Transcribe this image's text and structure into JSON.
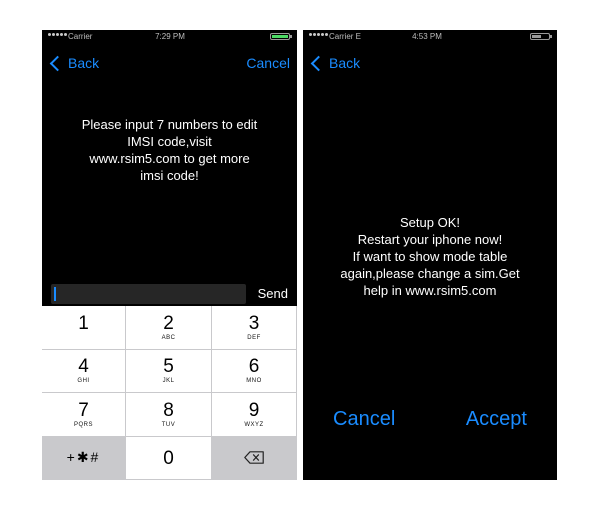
{
  "left_screen": {
    "status": {
      "carrier": "Carrier",
      "time": "7:29 PM",
      "battery_color": "#4cd964"
    },
    "nav": {
      "back_label": "Back",
      "cancel_label": "Cancel"
    },
    "message": "Please input 7 numbers to edit\nIMSI code,visit\nwww.rsim5.com to get more\nimsi code!",
    "input": {
      "value": "",
      "placeholder": ""
    },
    "send_label": "Send",
    "keypad": {
      "keys": [
        {
          "digit": "1",
          "letters": ""
        },
        {
          "digit": "2",
          "letters": "ABC"
        },
        {
          "digit": "3",
          "letters": "DEF"
        },
        {
          "digit": "4",
          "letters": "GHI"
        },
        {
          "digit": "5",
          "letters": "JKL"
        },
        {
          "digit": "6",
          "letters": "MNO"
        },
        {
          "digit": "7",
          "letters": "PQRS"
        },
        {
          "digit": "8",
          "letters": "TUV"
        },
        {
          "digit": "9",
          "letters": "WXYZ"
        }
      ],
      "symbols_label": "+✱#",
      "zero": "0",
      "backspace_icon": "backspace-icon"
    }
  },
  "right_screen": {
    "status": {
      "carrier": "Carrier  E",
      "time": "4:53 PM",
      "battery_color": "#9a9a9a"
    },
    "nav": {
      "back_label": "Back"
    },
    "message": "Setup OK!\nRestart your iphone now!\nIf want to show mode table\nagain,please change a sim.Get\nhelp in www.rsim5.com",
    "cancel_label": "Cancel",
    "accept_label": "Accept"
  },
  "colors": {
    "accent": "#1a8cff",
    "screen_bg": "#000000",
    "keypad_gray": "#c9c9cc"
  }
}
